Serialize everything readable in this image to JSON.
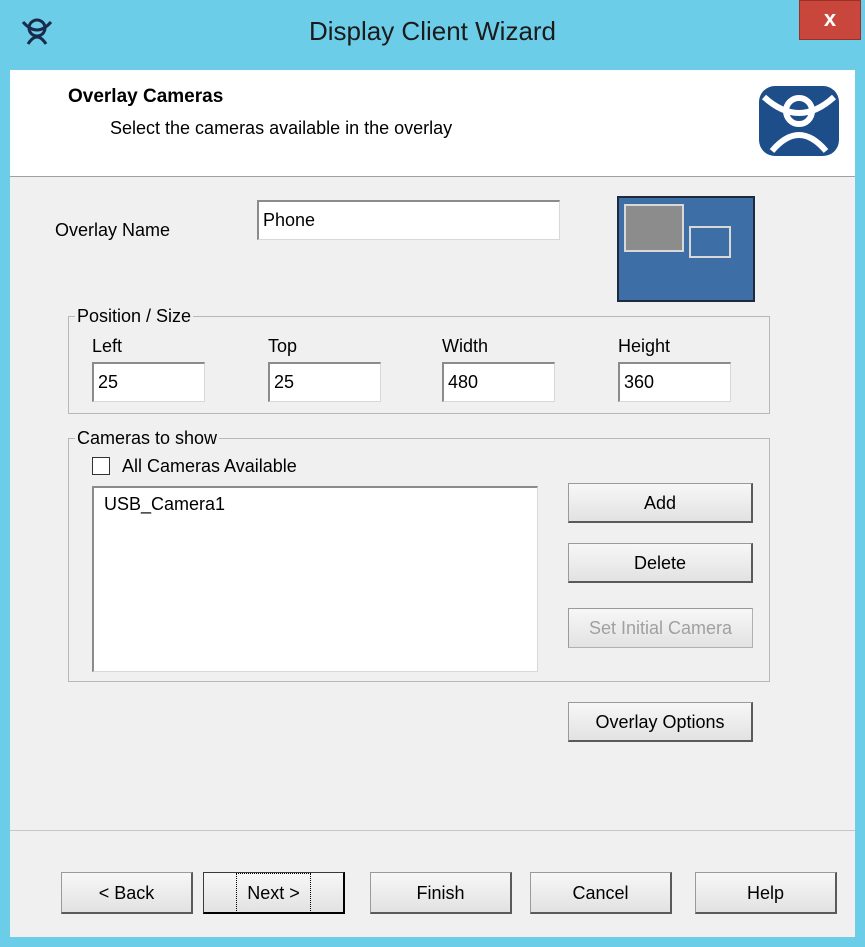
{
  "window": {
    "title": "Display Client Wizard",
    "close_label": "x"
  },
  "header": {
    "title": "Overlay Cameras",
    "subtitle": "Select the cameras available in the overlay",
    "logo_icon": "thinmanager-logo-icon"
  },
  "overlay_name": {
    "label": "Overlay Name",
    "value": "Phone"
  },
  "position_size": {
    "legend": "Position / Size",
    "left": {
      "label": "Left",
      "value": "25"
    },
    "top": {
      "label": "Top",
      "value": "25"
    },
    "width": {
      "label": "Width",
      "value": "480"
    },
    "height": {
      "label": "Height",
      "value": "360"
    }
  },
  "cameras": {
    "legend": "Cameras to show",
    "all_cameras_label": "All Cameras Available",
    "all_cameras_checked": false,
    "items": [
      "USB_Camera1"
    ],
    "add_label": "Add",
    "delete_label": "Delete",
    "set_initial_label": "Set Initial Camera"
  },
  "overlay_options_label": "Overlay Options",
  "footer": {
    "back_label": "< Back",
    "next_label": "Next >",
    "finish_label": "Finish",
    "cancel_label": "Cancel",
    "help_label": "Help"
  },
  "colors": {
    "titlebar": "#6ccde8",
    "close_button": "#c9463d",
    "preview_background": "#3d6fa6"
  }
}
